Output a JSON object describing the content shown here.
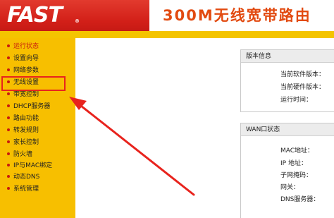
{
  "header": {
    "logo": "FAST",
    "logo_mark": "®",
    "title": "300M无线宽带路由"
  },
  "sidebar": {
    "items": [
      {
        "label": "运行状态",
        "active": true
      },
      {
        "label": "设置向导",
        "active": false
      },
      {
        "label": "网络参数",
        "active": false
      },
      {
        "label": "无线设置",
        "active": false
      },
      {
        "label": "带宽控制",
        "active": false
      },
      {
        "label": "DHCP服务器",
        "active": false
      },
      {
        "label": "路由功能",
        "active": false
      },
      {
        "label": "转发规则",
        "active": false
      },
      {
        "label": "家长控制",
        "active": false
      },
      {
        "label": "防火墙",
        "active": false
      },
      {
        "label": "IP与MAC绑定",
        "active": false
      },
      {
        "label": "动态DNS",
        "active": false
      },
      {
        "label": "系统管理",
        "active": false
      }
    ]
  },
  "version_panel": {
    "title": "版本信息",
    "rows": [
      "当前软件版本：",
      "当前硬件版本：",
      "运行时间："
    ]
  },
  "wan_panel": {
    "title": "WAN口状态",
    "rows": [
      "MAC地址：",
      "IP 地址：",
      "子网掩码：",
      "网关：",
      "DNS服务器："
    ]
  },
  "colors": {
    "header_red": "#d21f18",
    "sidebar_yellow": "#f7bf00",
    "title_orange": "#e24a10",
    "annotation_red": "#e8231d"
  }
}
